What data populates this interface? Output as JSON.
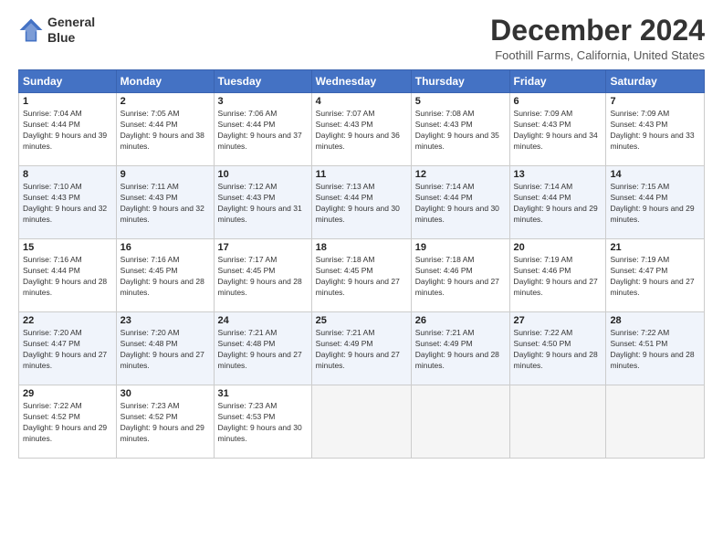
{
  "logo": {
    "line1": "General",
    "line2": "Blue"
  },
  "title": "December 2024",
  "subtitle": "Foothill Farms, California, United States",
  "header_days": [
    "Sunday",
    "Monday",
    "Tuesday",
    "Wednesday",
    "Thursday",
    "Friday",
    "Saturday"
  ],
  "weeks": [
    [
      {
        "day": "1",
        "rise": "7:04 AM",
        "set": "4:44 PM",
        "daylight": "9 hours and 39 minutes."
      },
      {
        "day": "2",
        "rise": "7:05 AM",
        "set": "4:44 PM",
        "daylight": "9 hours and 38 minutes."
      },
      {
        "day": "3",
        "rise": "7:06 AM",
        "set": "4:44 PM",
        "daylight": "9 hours and 37 minutes."
      },
      {
        "day": "4",
        "rise": "7:07 AM",
        "set": "4:43 PM",
        "daylight": "9 hours and 36 minutes."
      },
      {
        "day": "5",
        "rise": "7:08 AM",
        "set": "4:43 PM",
        "daylight": "9 hours and 35 minutes."
      },
      {
        "day": "6",
        "rise": "7:09 AM",
        "set": "4:43 PM",
        "daylight": "9 hours and 34 minutes."
      },
      {
        "day": "7",
        "rise": "7:09 AM",
        "set": "4:43 PM",
        "daylight": "9 hours and 33 minutes."
      }
    ],
    [
      {
        "day": "8",
        "rise": "7:10 AM",
        "set": "4:43 PM",
        "daylight": "9 hours and 32 minutes."
      },
      {
        "day": "9",
        "rise": "7:11 AM",
        "set": "4:43 PM",
        "daylight": "9 hours and 32 minutes."
      },
      {
        "day": "10",
        "rise": "7:12 AM",
        "set": "4:43 PM",
        "daylight": "9 hours and 31 minutes."
      },
      {
        "day": "11",
        "rise": "7:13 AM",
        "set": "4:44 PM",
        "daylight": "9 hours and 30 minutes."
      },
      {
        "day": "12",
        "rise": "7:14 AM",
        "set": "4:44 PM",
        "daylight": "9 hours and 30 minutes."
      },
      {
        "day": "13",
        "rise": "7:14 AM",
        "set": "4:44 PM",
        "daylight": "9 hours and 29 minutes."
      },
      {
        "day": "14",
        "rise": "7:15 AM",
        "set": "4:44 PM",
        "daylight": "9 hours and 29 minutes."
      }
    ],
    [
      {
        "day": "15",
        "rise": "7:16 AM",
        "set": "4:44 PM",
        "daylight": "9 hours and 28 minutes."
      },
      {
        "day": "16",
        "rise": "7:16 AM",
        "set": "4:45 PM",
        "daylight": "9 hours and 28 minutes."
      },
      {
        "day": "17",
        "rise": "7:17 AM",
        "set": "4:45 PM",
        "daylight": "9 hours and 28 minutes."
      },
      {
        "day": "18",
        "rise": "7:18 AM",
        "set": "4:45 PM",
        "daylight": "9 hours and 27 minutes."
      },
      {
        "day": "19",
        "rise": "7:18 AM",
        "set": "4:46 PM",
        "daylight": "9 hours and 27 minutes."
      },
      {
        "day": "20",
        "rise": "7:19 AM",
        "set": "4:46 PM",
        "daylight": "9 hours and 27 minutes."
      },
      {
        "day": "21",
        "rise": "7:19 AM",
        "set": "4:47 PM",
        "daylight": "9 hours and 27 minutes."
      }
    ],
    [
      {
        "day": "22",
        "rise": "7:20 AM",
        "set": "4:47 PM",
        "daylight": "9 hours and 27 minutes."
      },
      {
        "day": "23",
        "rise": "7:20 AM",
        "set": "4:48 PM",
        "daylight": "9 hours and 27 minutes."
      },
      {
        "day": "24",
        "rise": "7:21 AM",
        "set": "4:48 PM",
        "daylight": "9 hours and 27 minutes."
      },
      {
        "day": "25",
        "rise": "7:21 AM",
        "set": "4:49 PM",
        "daylight": "9 hours and 27 minutes."
      },
      {
        "day": "26",
        "rise": "7:21 AM",
        "set": "4:49 PM",
        "daylight": "9 hours and 28 minutes."
      },
      {
        "day": "27",
        "rise": "7:22 AM",
        "set": "4:50 PM",
        "daylight": "9 hours and 28 minutes."
      },
      {
        "day": "28",
        "rise": "7:22 AM",
        "set": "4:51 PM",
        "daylight": "9 hours and 28 minutes."
      }
    ],
    [
      {
        "day": "29",
        "rise": "7:22 AM",
        "set": "4:52 PM",
        "daylight": "9 hours and 29 minutes."
      },
      {
        "day": "30",
        "rise": "7:23 AM",
        "set": "4:52 PM",
        "daylight": "9 hours and 29 minutes."
      },
      {
        "day": "31",
        "rise": "7:23 AM",
        "set": "4:53 PM",
        "daylight": "9 hours and 30 minutes."
      },
      null,
      null,
      null,
      null
    ]
  ],
  "labels": {
    "sunrise": "Sunrise:",
    "sunset": "Sunset:",
    "daylight": "Daylight:"
  }
}
